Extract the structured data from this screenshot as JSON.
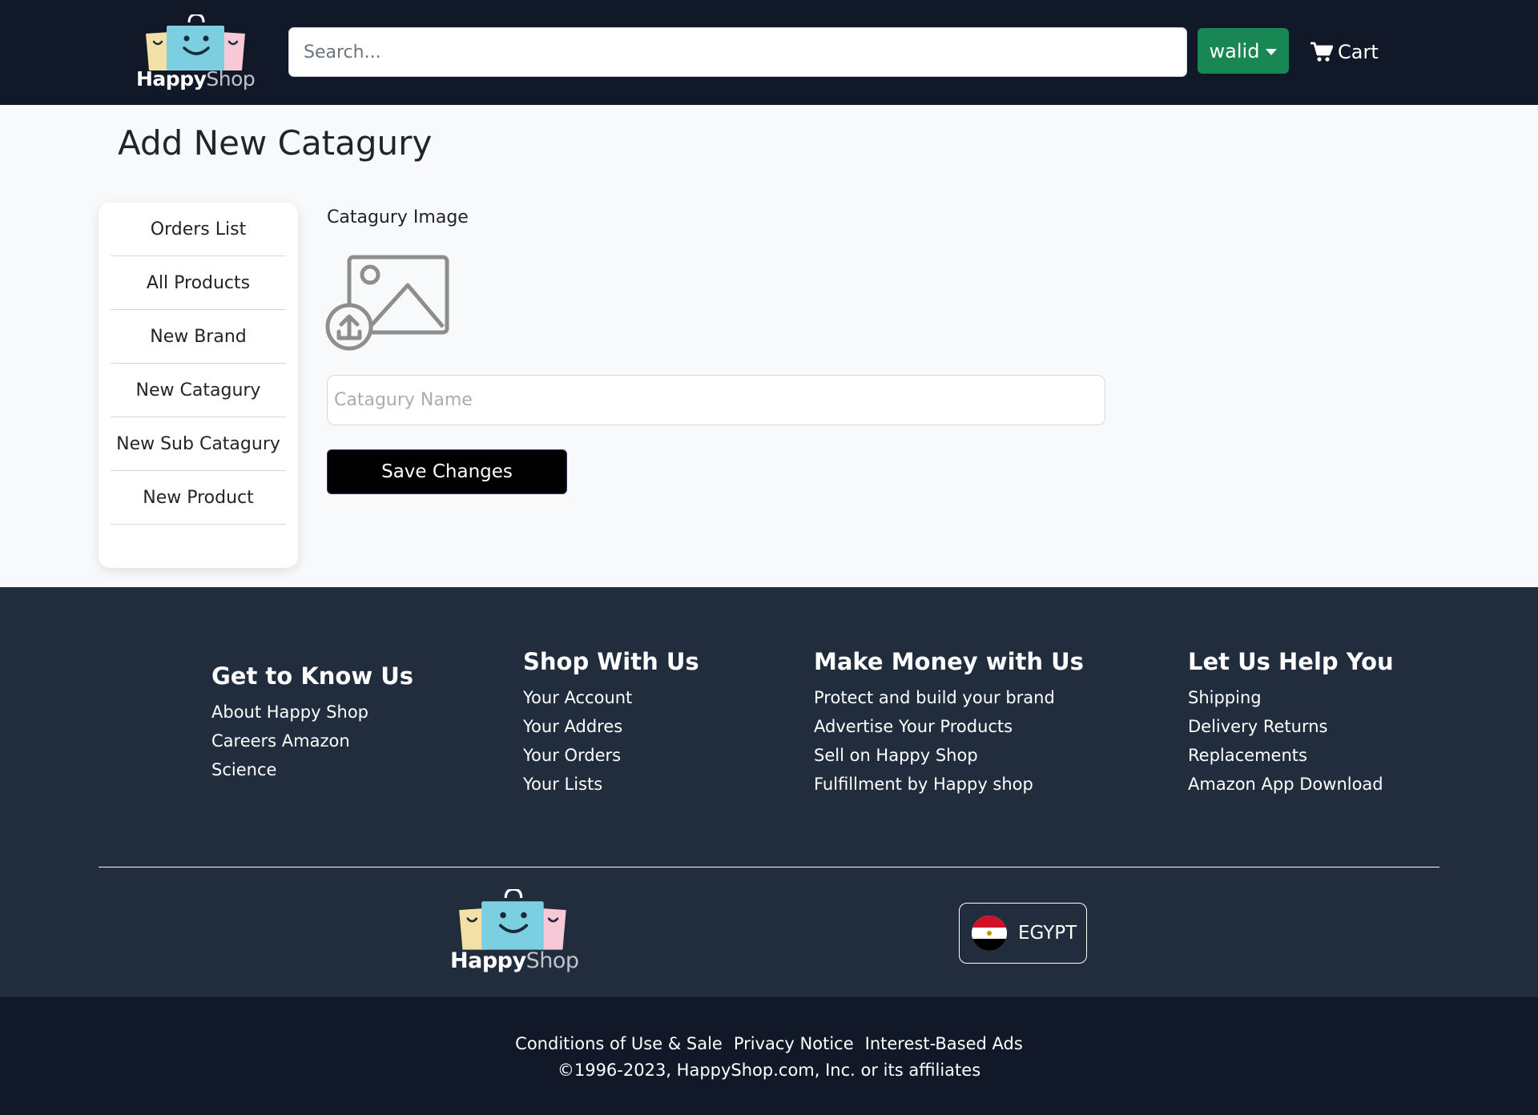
{
  "header": {
    "logo": {
      "word_a": "Happy",
      "word_b": "Shop"
    },
    "search": {
      "placeholder": "Search..."
    },
    "user": {
      "label": "walid"
    },
    "cart": {
      "label": "Cart"
    }
  },
  "main": {
    "title": "Add New Catagury",
    "sidebar": {
      "items": [
        {
          "label": "Orders List"
        },
        {
          "label": "All Products"
        },
        {
          "label": "New Brand"
        },
        {
          "label": "New Catagury"
        },
        {
          "label": "New Sub Catagury"
        },
        {
          "label": "New Product"
        }
      ]
    },
    "form": {
      "image_label": "Catagury Image",
      "name_placeholder": "Catagury Name",
      "name_value": "",
      "save_label": "Save Changes"
    }
  },
  "footer": {
    "columns": [
      {
        "title": "Get to Know Us",
        "links": [
          "About Happy Shop",
          "Careers Amazon",
          "Science"
        ]
      },
      {
        "title": "Shop With Us",
        "links": [
          "Your Account",
          "Your Addres",
          "Your Orders",
          "Your Lists"
        ]
      },
      {
        "title": "Make Money with Us",
        "links": [
          "Protect and build your brand",
          "Advertise Your Products",
          "Sell on Happy Shop",
          "Fulfillment by Happy shop"
        ]
      },
      {
        "title": "Let Us Help You",
        "links": [
          "Shipping",
          "Delivery Returns",
          "Replacements",
          "Amazon App Download"
        ]
      }
    ],
    "logo": {
      "word_a": "Happy",
      "word_b": "Shop"
    },
    "country": {
      "label": "EGYPT"
    },
    "legal_links": [
      "Conditions of Use & Sale",
      "Privacy Notice",
      "Interest-Based Ads"
    ],
    "copyright": "©1996-2023, HappyShop.com, Inc. or its affiliates"
  },
  "colors": {
    "header_bg": "#111827",
    "footer_bg": "#212d3d",
    "user_button": "#198754",
    "save_button": "#000000",
    "bag_yellow": "#f3e0a6",
    "bag_blue": "#7ccfe0",
    "bag_pink": "#f7c8d6"
  }
}
